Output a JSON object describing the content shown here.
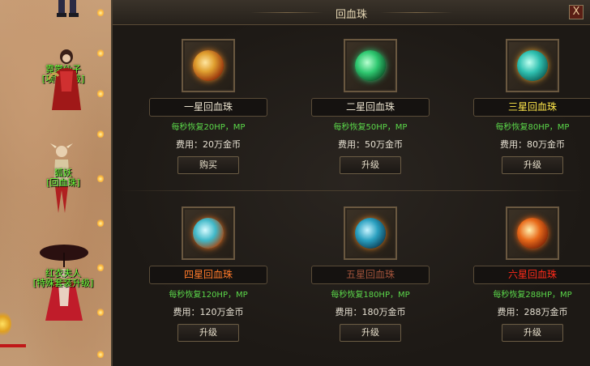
{
  "window": {
    "title": "回血珠",
    "close_label": "X"
  },
  "npcs": [
    {
      "name": "霓裳仙子",
      "sub": "[项链升级]"
    },
    {
      "name": "狐妖",
      "sub": "[回血珠]"
    },
    {
      "name": "红衣夫人",
      "sub": "[特殊套装升级]"
    }
  ],
  "items": [
    {
      "name": "一星回血珠",
      "name_color": "#e8e0cc",
      "effect": "每秒恢复20HP，MP",
      "cost": "费用：20万金币",
      "button": "购买",
      "orb_color": "#e0a030"
    },
    {
      "name": "二星回血珠",
      "name_color": "#e8e0cc",
      "effect": "每秒恢复50HP，MP",
      "cost": "费用：50万金币",
      "button": "升级",
      "orb_color": "#2fc870"
    },
    {
      "name": "三星回血珠",
      "name_color": "#ffe84a",
      "effect": "每秒恢复80HP，MP",
      "cost": "费用：80万金币",
      "button": "升级",
      "orb_color": "#2fc0b0"
    },
    {
      "name": "四星回血珠",
      "name_color": "#ff7a2a",
      "effect": "每秒恢复120HP，MP",
      "cost": "费用：120万金币",
      "button": "升级",
      "orb_color": "#40b8c8"
    },
    {
      "name": "五星回血珠",
      "name_color": "#a0523a",
      "effect": "每秒恢复180HP，MP",
      "cost": "费用：180万金币",
      "button": "升级",
      "orb_color": "#2aa0c0"
    },
    {
      "name": "六星回血珠",
      "name_color": "#ff2a1a",
      "effect": "每秒恢复288HP，MP",
      "cost": "费用：288万金币",
      "button": "升级",
      "orb_color": "#e86a1a"
    }
  ]
}
